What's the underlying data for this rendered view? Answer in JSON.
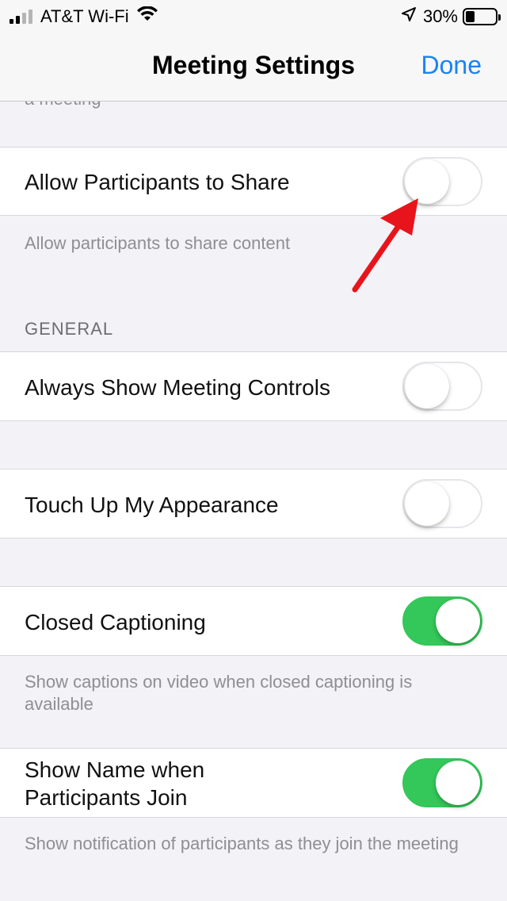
{
  "status_bar": {
    "carrier": "AT&T Wi-Fi",
    "battery_percent": "30%",
    "battery_level": 0.3
  },
  "nav": {
    "title": "Meeting Settings",
    "done_label": "Done"
  },
  "clipped_footer": "a meeting",
  "settings": [
    {
      "label": "Allow Participants to Share",
      "on": false,
      "footer": "Allow participants to share content"
    }
  ],
  "general": {
    "header": "GENERAL",
    "items": [
      {
        "label": "Always Show Meeting Controls",
        "on": false
      },
      {
        "label": "Touch Up My Appearance",
        "on": false
      },
      {
        "label": "Closed Captioning",
        "on": true,
        "footer": "Show captions on video when closed captioning is available"
      },
      {
        "label": "Show Name when Participants Join",
        "on": true,
        "footer": "Show notification of participants as they join the meeting"
      }
    ]
  },
  "colors": {
    "accent": "#1a82f5",
    "toggle_on": "#34c759",
    "annotation_arrow": "#e8141b"
  }
}
